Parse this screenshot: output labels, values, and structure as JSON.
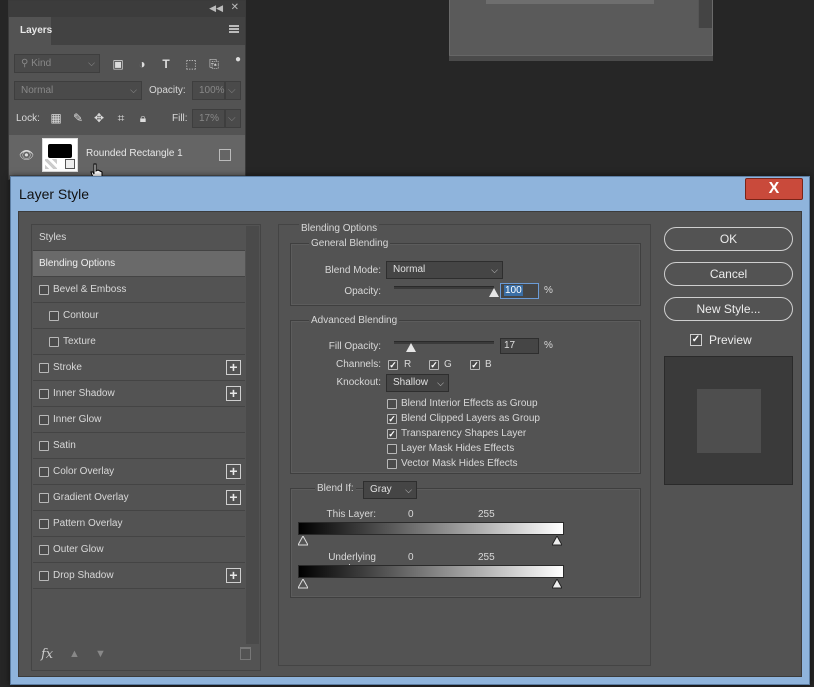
{
  "layers_panel": {
    "tab_label": "Layers",
    "kind_placeholder": "Kind",
    "blend_mode": "Normal",
    "opacity_label": "Opacity:",
    "opacity_value": "100%",
    "lock_label": "Lock:",
    "fill_label": "Fill:",
    "fill_value": "17%",
    "layer_name": "Rounded Rectangle 1"
  },
  "dialog": {
    "title": "Layer Style",
    "close_label": "X"
  },
  "style_list": {
    "items": [
      {
        "label": "Styles",
        "checkbox": false,
        "plus": false,
        "active": false,
        "indent": false
      },
      {
        "label": "Blending Options",
        "checkbox": false,
        "plus": false,
        "active": true,
        "indent": false
      },
      {
        "label": "Bevel & Emboss",
        "checkbox": true,
        "plus": false,
        "active": false,
        "indent": false
      },
      {
        "label": "Contour",
        "checkbox": true,
        "plus": false,
        "active": false,
        "indent": true
      },
      {
        "label": "Texture",
        "checkbox": true,
        "plus": false,
        "active": false,
        "indent": true
      },
      {
        "label": "Stroke",
        "checkbox": true,
        "plus": true,
        "active": false,
        "indent": false
      },
      {
        "label": "Inner Shadow",
        "checkbox": true,
        "plus": true,
        "active": false,
        "indent": false
      },
      {
        "label": "Inner Glow",
        "checkbox": true,
        "plus": false,
        "active": false,
        "indent": false
      },
      {
        "label": "Satin",
        "checkbox": true,
        "plus": false,
        "active": false,
        "indent": false
      },
      {
        "label": "Color Overlay",
        "checkbox": true,
        "plus": true,
        "active": false,
        "indent": false
      },
      {
        "label": "Gradient Overlay",
        "checkbox": true,
        "plus": true,
        "active": false,
        "indent": false
      },
      {
        "label": "Pattern Overlay",
        "checkbox": true,
        "plus": false,
        "active": false,
        "indent": false
      },
      {
        "label": "Outer Glow",
        "checkbox": true,
        "plus": false,
        "active": false,
        "indent": false
      },
      {
        "label": "Drop Shadow",
        "checkbox": true,
        "plus": true,
        "active": false,
        "indent": false
      }
    ],
    "fx_label": "fx"
  },
  "blending": {
    "section_title": "Blending Options",
    "general_title": "General Blending",
    "blend_mode_label": "Blend Mode:",
    "blend_mode_value": "Normal",
    "opacity_label": "Opacity:",
    "opacity_value": "100",
    "opacity_level": 1.0,
    "pct": "%",
    "advanced_title": "Advanced Blending",
    "fill_opacity_label": "Fill Opacity:",
    "fill_opacity_value": "17",
    "fill_opacity_level": 0.17,
    "channels_label": "Channels:",
    "channel_r": "R",
    "channel_g": "G",
    "channel_b": "B",
    "knockout_label": "Knockout:",
    "knockout_value": "Shallow",
    "options": [
      {
        "label": "Blend Interior Effects as Group",
        "checked": false
      },
      {
        "label": "Blend Clipped Layers as Group",
        "checked": true
      },
      {
        "label": "Transparency Shapes Layer",
        "checked": true
      },
      {
        "label": "Layer Mask Hides Effects",
        "checked": false
      },
      {
        "label": "Vector Mask Hides Effects",
        "checked": false
      }
    ],
    "blend_if_label": "Blend If:",
    "blend_if_value": "Gray",
    "this_layer_label": "This Layer:",
    "underlying_label": "Underlying Layer:",
    "min_value": "0",
    "max_value": "255"
  },
  "buttons": {
    "ok": "OK",
    "cancel": "Cancel",
    "new_style": "New Style...",
    "preview_label": "Preview"
  }
}
